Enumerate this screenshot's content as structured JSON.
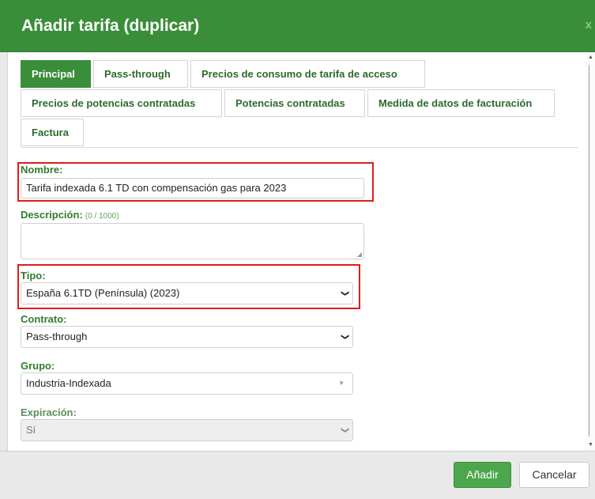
{
  "dialog": {
    "title": "Añadir tarifa (duplicar)",
    "close_label": "x"
  },
  "tabs": [
    {
      "label": "Principal",
      "active": true
    },
    {
      "label": "Pass-through",
      "active": false
    },
    {
      "label": "Precios de consumo de tarifa de acceso",
      "active": false
    },
    {
      "label": "Precios de potencias contratadas",
      "active": false
    },
    {
      "label": "Potencias contratadas",
      "active": false
    },
    {
      "label": "Medida de datos de facturación",
      "active": false
    },
    {
      "label": "Factura",
      "active": false
    }
  ],
  "form": {
    "nombre": {
      "label": "Nombre:",
      "value": "Tarifa indexada 6.1 TD con compensación gas para 2023"
    },
    "descripcion": {
      "label": "Descripción:",
      "counter": "(0 / 1000)",
      "value": ""
    },
    "tipo": {
      "label": "Tipo:",
      "value": "España 6.1TD (Península) (2023)"
    },
    "contrato": {
      "label": "Contrato:",
      "value": "Pass-through"
    },
    "grupo": {
      "label": "Grupo:",
      "value": "Industria-Indexada"
    },
    "expiracion": {
      "label": "Expiración:",
      "value": "Sí",
      "disabled": true
    }
  },
  "footer": {
    "add_label": "Añadir",
    "cancel_label": "Cancelar"
  },
  "colors": {
    "header_green": "#3a8e3a",
    "label_green": "#2f7d2f",
    "highlight_red": "#e11b1b",
    "footer_bg": "#e9e9e9"
  }
}
